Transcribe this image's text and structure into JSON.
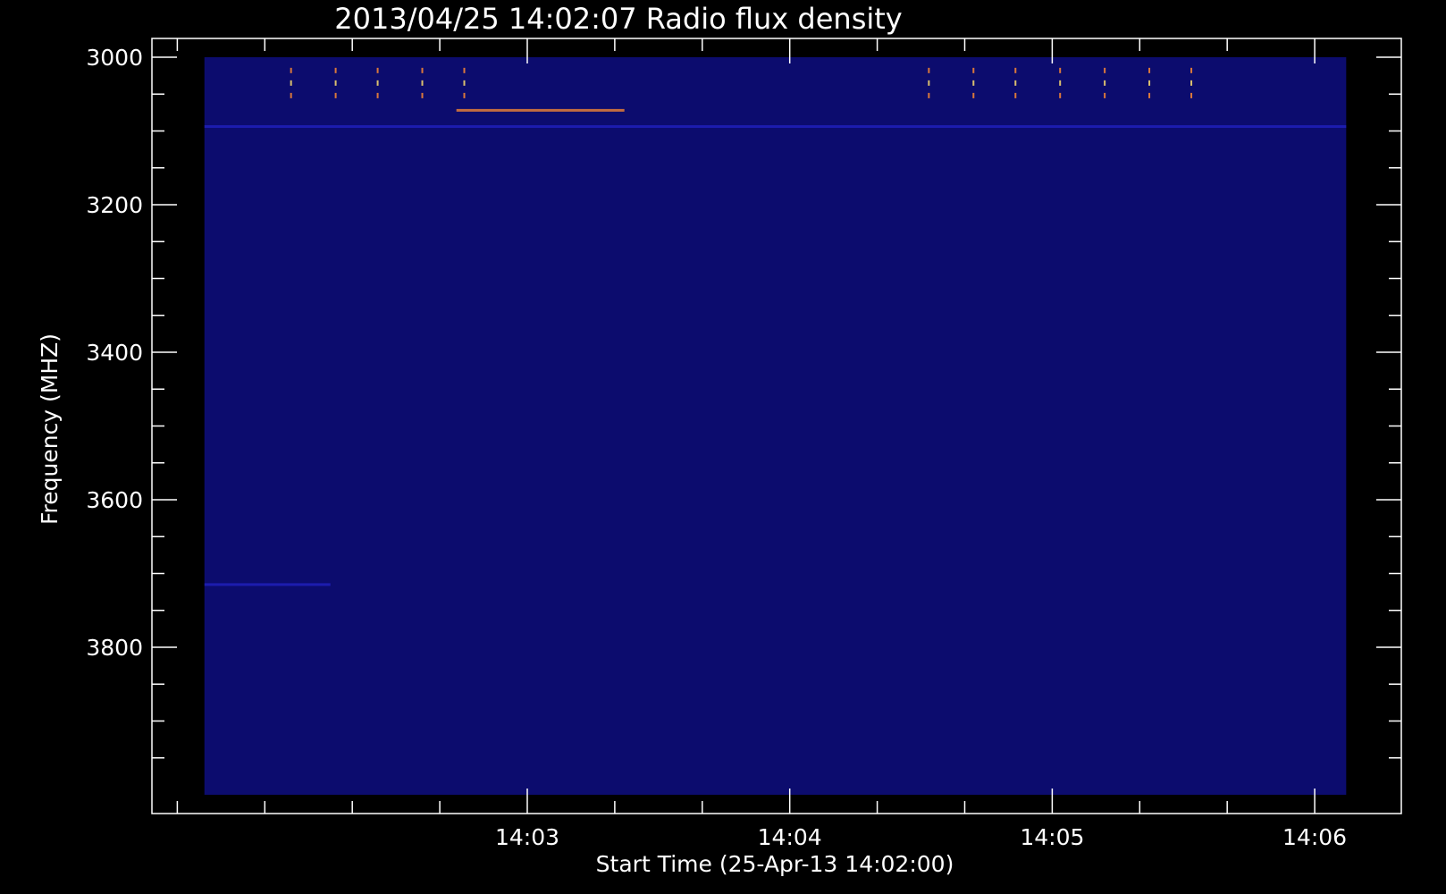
{
  "chart_data": {
    "type": "heatmap",
    "title": "2013/04/25 14:02:07 Radio flux density",
    "xlabel": "Start Time (25-Apr-13 14:02:00)",
    "ylabel": "Frequency (MHZ)",
    "x_ticks": [
      "14:03",
      "14:04",
      "14:05",
      "14:06"
    ],
    "x_tick_minutes": [
      1,
      2,
      3,
      4
    ],
    "x_range_minutes": [
      -0.43,
      4.33
    ],
    "data_x_range_minutes": [
      -0.23,
      4.12
    ],
    "y_ticks": [
      3000,
      3200,
      3400,
      3600,
      3800
    ],
    "y_range": [
      3000,
      4000
    ],
    "y_reversed": true,
    "colors": {
      "background": "#000000",
      "axis": "#ffffff",
      "field": "#0c0c6e",
      "bright": "#ff8c32",
      "hot": "#ffe070"
    },
    "features": [
      {
        "kind": "band",
        "freq": 3072,
        "t_start": 0.73,
        "t_end": 1.37,
        "intensity": "high"
      },
      {
        "kind": "band",
        "freq": 3094,
        "t_start": -0.23,
        "t_end": 4.12,
        "intensity": "low"
      },
      {
        "kind": "band",
        "freq": 3715,
        "t_start": -0.23,
        "t_end": 0.25,
        "intensity": "low"
      }
    ],
    "spikes_minutes": [
      0.1,
      0.27,
      0.43,
      0.6,
      0.76,
      2.53,
      2.7,
      2.86,
      3.03,
      3.2,
      3.37,
      3.53
    ]
  }
}
